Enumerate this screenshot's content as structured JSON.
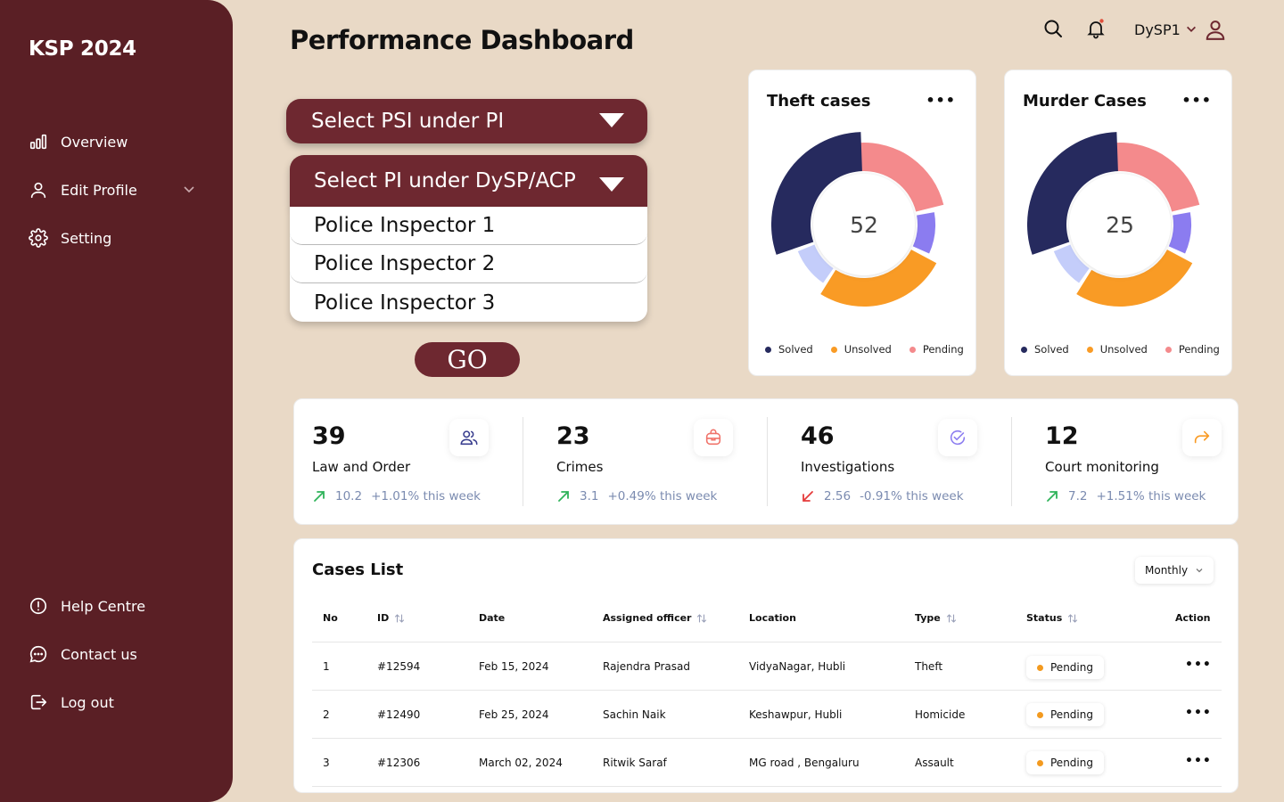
{
  "sidebar": {
    "brand": "KSP 2024",
    "nav": [
      {
        "label": "Overview",
        "icon": "bar-chart-icon"
      },
      {
        "label": "Edit Profile",
        "icon": "user-icon"
      },
      {
        "label": "Setting",
        "icon": "gear-icon"
      }
    ],
    "bottom": [
      {
        "label": "Help Centre",
        "icon": "info-icon"
      },
      {
        "label": "Contact us",
        "icon": "chat-icon"
      },
      {
        "label": "Log out",
        "icon": "logout-icon"
      }
    ]
  },
  "header": {
    "title": "Performance Dashboard",
    "user": "DySP1"
  },
  "filters": {
    "psi_select": "Select PSI under PI",
    "pi_select": "Select PI under DySP/ACP",
    "options": [
      "Police Inspector 1",
      "Police Inspector 2",
      "Police Inspector 3"
    ],
    "go": "GO"
  },
  "donuts": [
    {
      "title": "Theft cases",
      "center": "52"
    },
    {
      "title": "Murder Cases",
      "center": "25"
    }
  ],
  "legend": {
    "solved": "Solved",
    "unsolved": "Unsolved",
    "pending": "Pending"
  },
  "colors": {
    "sidebar": "#5a1f25",
    "accent": "#6e2830",
    "solved": "#262a5e",
    "unsolved": "#f99b25",
    "pending": "#f48a8c",
    "purple": "#8b7cf0",
    "lightblue": "#c4cdfa",
    "up": "#2fb35a",
    "down": "#e53b3b"
  },
  "stats": [
    {
      "value": "39",
      "label": "Law and Order",
      "delta": "10.2",
      "pct": "+1.01% this week",
      "dir": "up",
      "icon": "users-icon"
    },
    {
      "value": "23",
      "label": "Crimes",
      "delta": "3.1",
      "pct": "+0.49% this week",
      "dir": "up",
      "icon": "bag-icon"
    },
    {
      "value": "46",
      "label": "Investigations",
      "delta": "2.56",
      "pct": "-0.91% this week",
      "dir": "down",
      "icon": "check-circle-icon"
    },
    {
      "value": "12",
      "label": "Court monitoring",
      "delta": "7.2",
      "pct": "+1.51% this week",
      "dir": "up",
      "icon": "forward-icon"
    }
  ],
  "cases": {
    "title": "Cases List",
    "period": "Monthly",
    "columns": [
      "No",
      "ID",
      "Date",
      "Assigned officer",
      "Location",
      "Type",
      "Status",
      "Action"
    ],
    "rows": [
      {
        "no": "1",
        "id": "#12594",
        "date": "Feb 15, 2024",
        "officer": "Rajendra Prasad",
        "location": "VidyaNagar, Hubli",
        "type": "Theft",
        "status": "Pending"
      },
      {
        "no": "2",
        "id": "#12490",
        "date": "Feb 25, 2024",
        "officer": "Sachin Naik",
        "location": "Keshawpur, Hubli",
        "type": "Homicide",
        "status": "Pending"
      },
      {
        "no": "3",
        "id": "#12306",
        "date": "March 02, 2024",
        "officer": "Ritwik Saraf",
        "location": "MG road , Bengaluru",
        "type": "Assault",
        "status": "Pending"
      }
    ]
  }
}
